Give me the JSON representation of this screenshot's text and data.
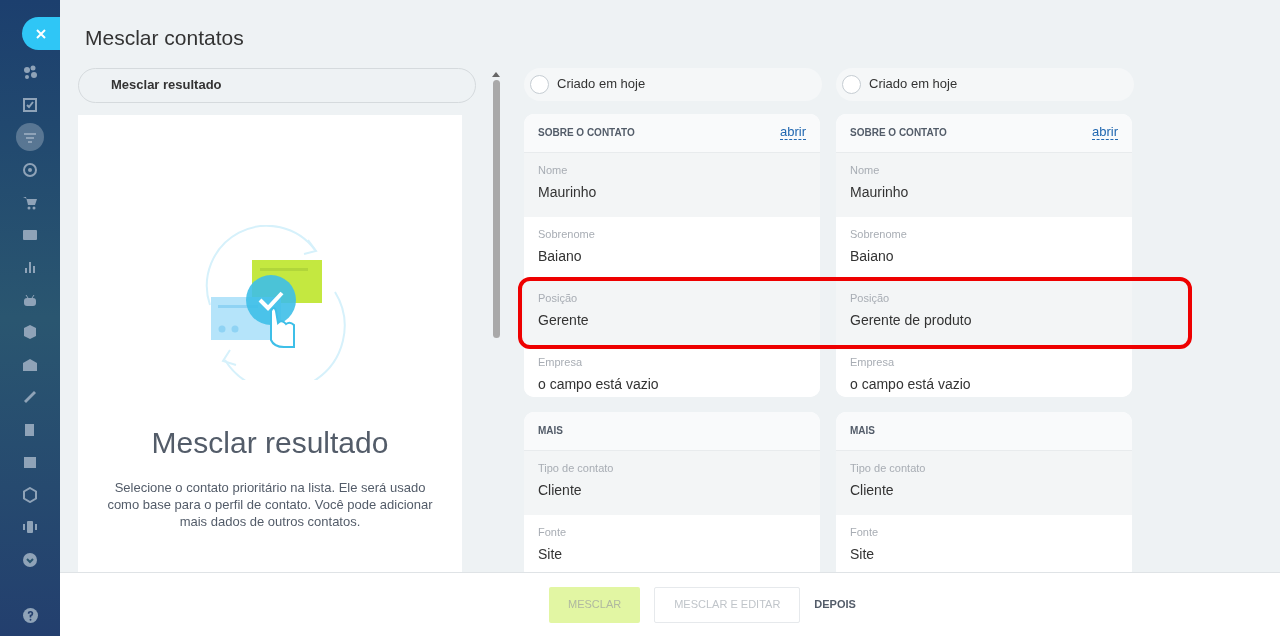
{
  "sidebar": {
    "items": [
      {
        "selected": false
      },
      {
        "selected": false
      },
      {
        "selected": true
      },
      {
        "selected": false
      },
      {
        "selected": false
      },
      {
        "selected": false
      },
      {
        "selected": false
      },
      {
        "selected": false
      },
      {
        "selected": false
      },
      {
        "selected": false
      },
      {
        "selected": false
      },
      {
        "selected": false
      },
      {
        "selected": false
      },
      {
        "selected": false
      },
      {
        "selected": false
      },
      {
        "selected": false
      }
    ]
  },
  "title": "Mesclar contatos",
  "result": {
    "tab": "Mesclar resultado",
    "heading": "Mesclar resultado",
    "description": "Selecione o contato prioritário na lista. Ele será usado como base para o perfil de contato. Você pode adicionar mais dados de outros contatos."
  },
  "contacts": [
    {
      "created": "Criado em hoje",
      "checked": false,
      "sections": [
        {
          "title": "SOBRE O CONTATO",
          "link": "abrir",
          "fields": [
            {
              "label": "Nome",
              "value": "Maurinho"
            },
            {
              "label": "Sobrenome",
              "value": "Baiano"
            },
            {
              "label": "Posição",
              "value": "Gerente"
            },
            {
              "label": "Empresa",
              "value": "o campo está vazio"
            }
          ]
        },
        {
          "title": "MAIS",
          "fields": [
            {
              "label": "Tipo de contato",
              "value": "Cliente"
            },
            {
              "label": "Fonte",
              "value": "Site"
            }
          ]
        }
      ]
    },
    {
      "created": "Criado em hoje",
      "checked": false,
      "sections": [
        {
          "title": "SOBRE O CONTATO",
          "link": "abrir",
          "fields": [
            {
              "label": "Nome",
              "value": "Maurinho"
            },
            {
              "label": "Sobrenome",
              "value": "Baiano"
            },
            {
              "label": "Posição",
              "value": "Gerente de produto"
            },
            {
              "label": "Empresa",
              "value": "o campo está vazio"
            }
          ]
        },
        {
          "title": "MAIS",
          "fields": [
            {
              "label": "Tipo de contato",
              "value": "Cliente"
            },
            {
              "label": "Fonte",
              "value": "Site"
            }
          ]
        }
      ]
    }
  ],
  "buttons": [
    {
      "label": "MESCLAR",
      "kind": "primary",
      "disabled": true
    },
    {
      "label": "MESCLAR E EDITAR",
      "kind": "outline",
      "disabled": true
    },
    {
      "label": "DEPOIS",
      "kind": "link",
      "disabled": false
    }
  ]
}
